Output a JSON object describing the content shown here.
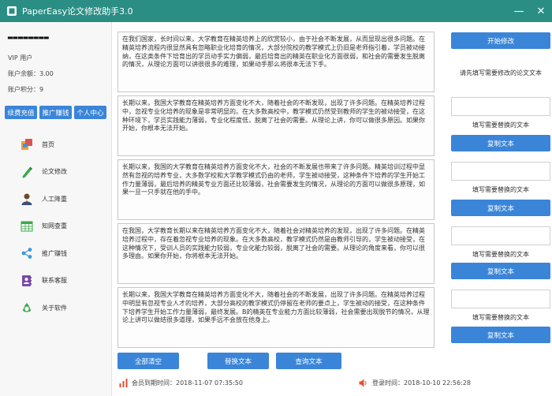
{
  "window": {
    "title": "PaperEasy论文修改助手3.0",
    "minimize": "—",
    "close": "✕"
  },
  "sidebar": {
    "username": "▬▬▬▬▬▬▬▬",
    "vip": "VIP 用户",
    "balance": "账户余额：3.00",
    "points": "账户积分：9",
    "buttons": [
      "续费充值",
      "推广赚钱",
      "个人中心"
    ],
    "nav": [
      {
        "label": "首页",
        "icon": "home-icon"
      },
      {
        "label": "论文修改",
        "icon": "pencil-icon"
      },
      {
        "label": "人工降重",
        "icon": "person-icon"
      },
      {
        "label": "知网查重",
        "icon": "table-icon"
      },
      {
        "label": "推广赚钱",
        "icon": "share-icon"
      },
      {
        "label": "联系客服",
        "icon": "contact-icon"
      },
      {
        "label": "关于软件",
        "icon": "recycle-icon"
      }
    ]
  },
  "main": {
    "texts": [
      "在我们国家，长时间以来，大学教育在精英培养上的欣赏较小，由于社会不断发展，从而显现出很多问题。在精英培养流程内很显然具有忽略职业化培育的情况，大部分院校的教学模式上仍旧是老师指引着，学员被动接纳，在这类条件下培育出的学员动手实力偏弱，最后培育出的精英在职业化方面很弱，和社会的需要发生脱离的情况，从理论方面可以讲很很多的难理，如果动手那么将很本无法下手。",
      "长期以来，我国大学教育在精英培养方面变化不大，随着社会的不断发现，出现了许多问题。在精英培养过程中，忽视专业化培养的现象是非常明显的。在大多数高校中，教学模式仍然受到教师的学生的被动接受，在这种环境下，学员实践能力薄弱，专业化程度低，脱离了社会的需要。从理论上讲，你可以做很多原因。如果你开始，你根本无法开始。",
      "长期以来，我国的大学教育在精英培养方面变化不大，社会的不断发展也带来了许多问题。精英培训过程中显然有忽视的培养专业，大多数学校和大学教学模式仍由的老师，学生被动接受，这种条件下培养的学生开始工作力量薄弱，最后培养的精英专业方面还比较薄弱，社会需要发生的情况，从理论的方面可以做很多原理，如果一旦一只手就在他的手中。",
      "在我国，大学教育长期以来在精英培养方面变化不大，随着社会对精英培养的发现，出现了许多问题。在精英培养过程中，存在着忽视专业培养的现象。在大多数高校，教学模式仍然是由教师引导的，学生被动接受，在这种情况下，受训人员的实践能力较弱，专业化能力较弱，脱离了社会的需要。从理论的角度来看，你可以很多理由。如果你开始，你将根本无法开始。",
      "长期以来，我国大学教育在精英培养方面变化不大，随着社会的不断发展，出现了许多问题。在精英培养过程中明显有忽视专业人才的培养，大部分高校的教学模式仍停留在老师的要点上，学生被动的接受，在这种条件下培养学生开始工作力量薄弱，最终发展。B的精英在专业能力方面比较薄弱，社会需要出现脱节的情况，从理论上讲可以做结很多道理，如果手远不会放在他身上。"
    ],
    "start_button": "开始修改",
    "prompt": "请先填写需要修改的论文文本",
    "replace_label": "填写需要替换的文本",
    "copy_button": "复制文本",
    "clear_button": "全部清空",
    "replace_button": "替换文本",
    "query_button": "查询文本"
  },
  "status": {
    "member_expiry": "会员到期时间：2018-11-07 07:35:50",
    "login_time": "登录时间：2018-10-10 22:56:28"
  },
  "colors": {
    "titlebar": "#2b8e84",
    "button": "#3a85d8",
    "accent_red": "#e2502e"
  }
}
